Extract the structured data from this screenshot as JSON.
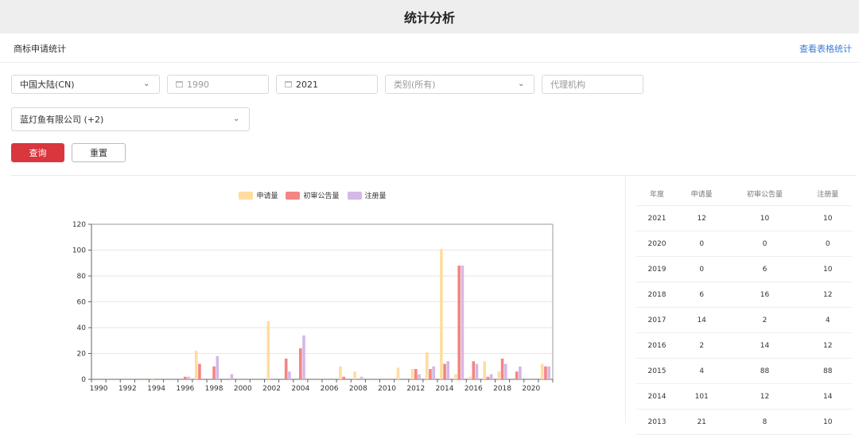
{
  "header": {
    "title": "统计分析"
  },
  "subheader": {
    "section_label": "商标申请统计",
    "table_link": "查看表格统计"
  },
  "filters": {
    "region": "中国大陆(CN)",
    "year_from": "1990",
    "year_to": "2021",
    "category": "类别(所有)",
    "agency_placeholder": "代理机构",
    "company": "蓝灯鱼有限公司 (+2)",
    "query_button": "查询",
    "reset_button": "重置"
  },
  "colors": {
    "primary": "#d9363e",
    "link": "#3a7bd5"
  },
  "chart_data": {
    "type": "bar",
    "ylim": [
      0,
      120
    ],
    "yticks": [
      0,
      20,
      40,
      60,
      80,
      100,
      120
    ],
    "x": [
      "1990",
      "1991",
      "1992",
      "1993",
      "1994",
      "1995",
      "1996",
      "1997",
      "1998",
      "1999",
      "2000",
      "2001",
      "2002",
      "2003",
      "2004",
      "2005",
      "2006",
      "2007",
      "2008",
      "2009",
      "2010",
      "2011",
      "2012",
      "2013",
      "2014",
      "2015",
      "2016",
      "2017",
      "2018",
      "2019",
      "2020",
      "2021"
    ],
    "xtick_labels": [
      "1990",
      "1992",
      "1994",
      "1996",
      "1998",
      "2000",
      "2002",
      "2004",
      "2006",
      "2008",
      "2010",
      "2012",
      "2014",
      "2016",
      "2018",
      "2020"
    ],
    "series": [
      {
        "name": "申请量",
        "color": "#ffdca0",
        "values": [
          0,
          0,
          0,
          0,
          1,
          0,
          0,
          22,
          0,
          0,
          0,
          0,
          45,
          0,
          0,
          0,
          0,
          10,
          6,
          0,
          0,
          9,
          8,
          21,
          101,
          4,
          2,
          14,
          6,
          0,
          0,
          12
        ]
      },
      {
        "name": "初审公告量",
        "color": "#f58484",
        "values": [
          0,
          0,
          0,
          0,
          0,
          0,
          2,
          12,
          10,
          0,
          0,
          0,
          0,
          16,
          24,
          0,
          0,
          2,
          0,
          0,
          0,
          0,
          8,
          8,
          12,
          88,
          14,
          2,
          16,
          6,
          0,
          10
        ]
      },
      {
        "name": "注册量",
        "color": "#d4b8e6",
        "values": [
          0,
          0,
          0,
          0,
          0,
          0,
          2,
          0,
          18,
          4,
          0,
          0,
          0,
          6,
          34,
          0,
          0,
          0,
          2,
          0,
          0,
          0,
          4,
          10,
          14,
          88,
          12,
          4,
          12,
          10,
          0,
          10
        ]
      }
    ]
  },
  "stats_table": {
    "headers": [
      "年度",
      "申请量",
      "初审公告量",
      "注册量"
    ],
    "rows": [
      [
        "2021",
        "12",
        "10",
        "10"
      ],
      [
        "2020",
        "0",
        "0",
        "0"
      ],
      [
        "2019",
        "0",
        "6",
        "10"
      ],
      [
        "2018",
        "6",
        "16",
        "12"
      ],
      [
        "2017",
        "14",
        "2",
        "4"
      ],
      [
        "2016",
        "2",
        "14",
        "12"
      ],
      [
        "2015",
        "4",
        "88",
        "88"
      ],
      [
        "2014",
        "101",
        "12",
        "14"
      ],
      [
        "2013",
        "21",
        "8",
        "10"
      ]
    ]
  }
}
